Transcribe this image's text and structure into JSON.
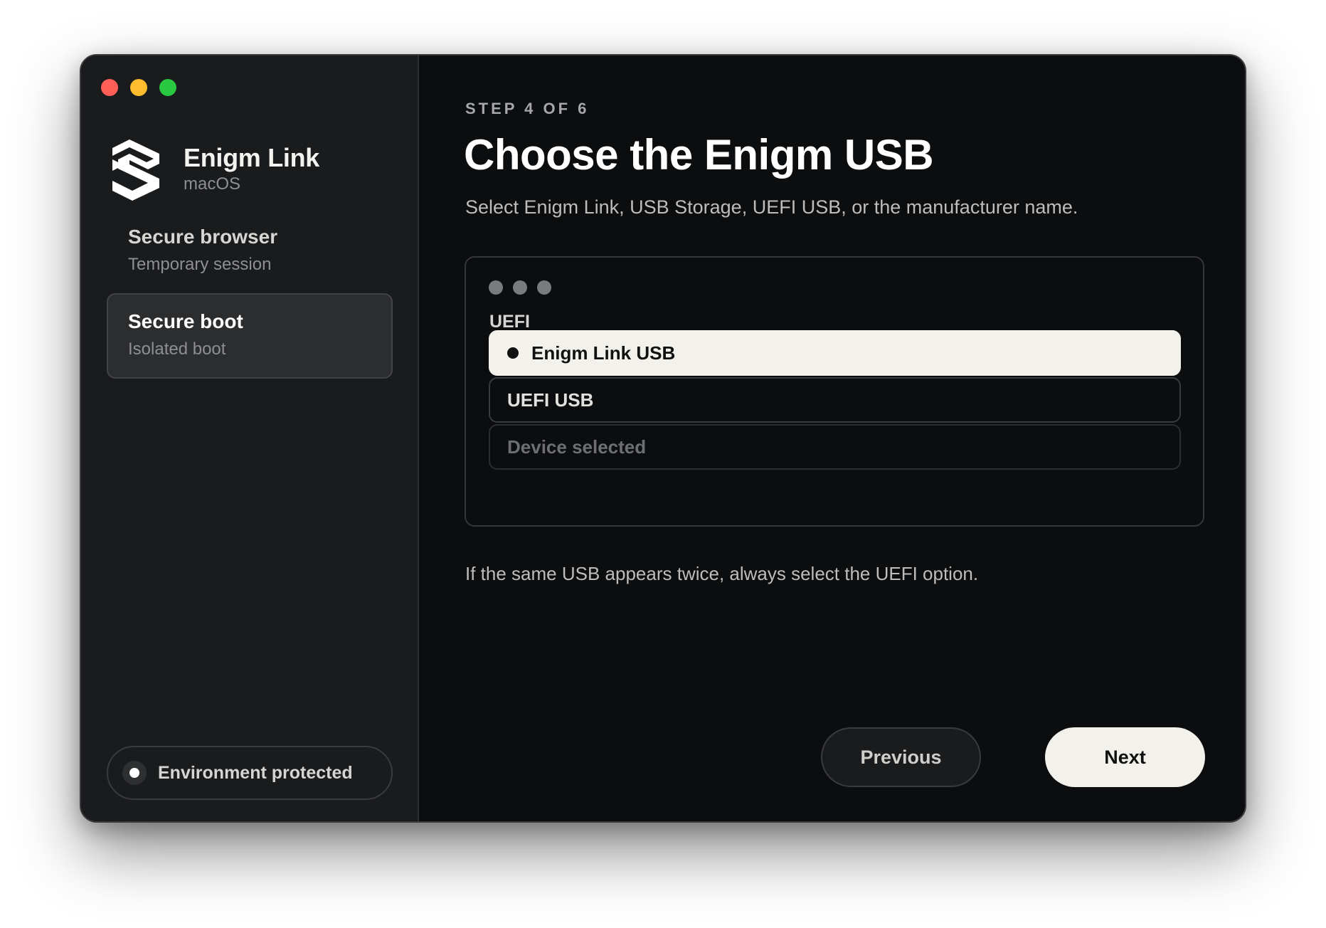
{
  "window": {
    "traffic_lights": [
      {
        "name": "close",
        "color": "#ff5f57"
      },
      {
        "name": "minimize",
        "color": "#febc2e"
      },
      {
        "name": "zoom",
        "color": "#28c840"
      }
    ]
  },
  "sidebar": {
    "brand_name": "Enigm Link",
    "brand_platform": "macOS",
    "logo_icon": "enigm-link-logo",
    "items": [
      {
        "title": "Secure browser",
        "subtitle": "Temporary session",
        "active": false
      },
      {
        "title": "Secure boot",
        "subtitle": "Isolated boot",
        "active": true
      }
    ],
    "status_label": "Environment protected"
  },
  "main": {
    "step": "STEP 4 OF 6",
    "title": "Choose the Enigm USB",
    "subtitle": "Select Enigm Link, USB Storage, UEFI USB, or the manufacturer name.",
    "panel": {
      "group_label": "UEFI",
      "options": [
        {
          "label": "Enigm Link USB",
          "selected": true
        },
        {
          "label": "UEFI USB",
          "selected": false
        },
        {
          "label": "Device selected",
          "selected": false
        }
      ]
    },
    "note": "If the same USB appears twice, always select the UEFI option.",
    "previous_label": "Previous",
    "next_label": "Next"
  }
}
